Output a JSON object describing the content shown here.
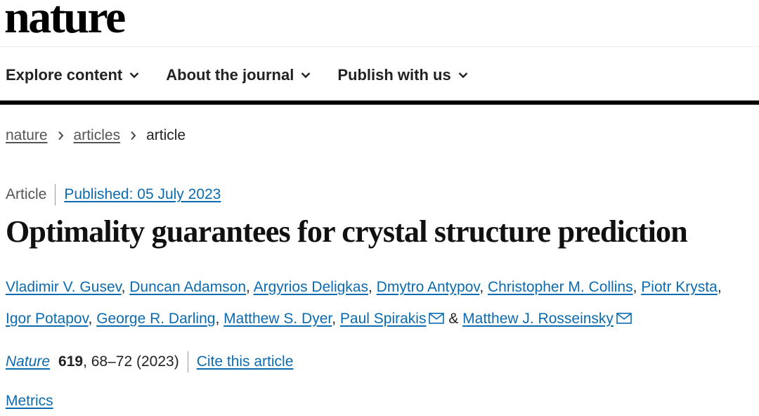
{
  "site": {
    "logo": "nature"
  },
  "nav": {
    "items": [
      {
        "label": "Explore content"
      },
      {
        "label": "About the journal"
      },
      {
        "label": "Publish with us"
      }
    ]
  },
  "breadcrumb": {
    "items": [
      {
        "label": "nature"
      },
      {
        "label": "articles"
      }
    ],
    "current": "article"
  },
  "article": {
    "type": "Article",
    "published": "Published: 05 July 2023",
    "title": "Optimality guarantees for crystal structure prediction",
    "authors": [
      "Vladimir V. Gusev",
      "Duncan Adamson",
      "Argyrios Deligkas",
      "Dmytro Antypov",
      "Christopher M. Collins",
      "Piotr Krysta",
      "Igor Potapov",
      "George R. Darling",
      "Matthew S. Dyer",
      "Paul Spirakis",
      "Matthew J. Rosseinsky"
    ],
    "author_separator": ",",
    "author_ampersand": "&",
    "citation": {
      "journal": "Nature",
      "volume": "619",
      "pages_year": ", 68–72 (2023)",
      "cite_label": "Cite this article"
    },
    "metrics_label": "Metrics"
  },
  "colors": {
    "link": "#0c6bb0",
    "text": "#222222",
    "rule": "#000000"
  },
  "icons": {
    "nav_chevron": "chevron-down-icon",
    "breadcrumb_sep": "chevron-right-icon",
    "email": "envelope-icon"
  }
}
